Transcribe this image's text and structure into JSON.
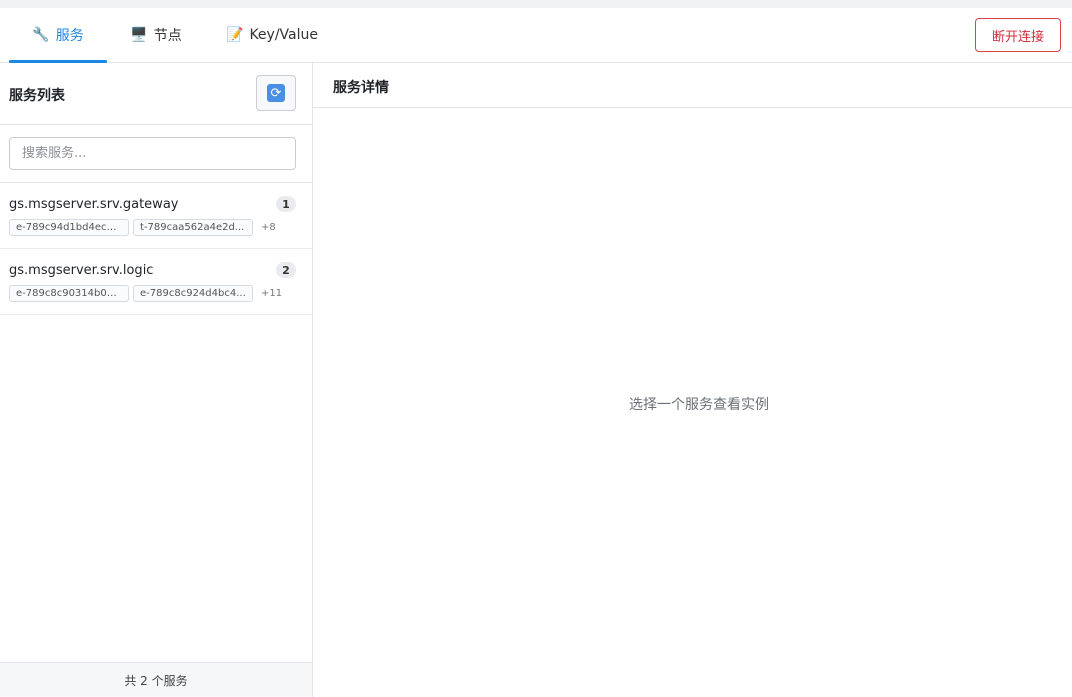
{
  "tabs": [
    {
      "icon": "🔧",
      "label": "服务",
      "active": true
    },
    {
      "icon": "🖥️",
      "label": "节点",
      "active": false
    },
    {
      "icon": "📝",
      "label": "Key/Value",
      "active": false
    }
  ],
  "disconnect_label": "断开连接",
  "services_panel": {
    "title": "服务列表",
    "refresh_icon": "refresh-icon",
    "search_placeholder": "搜索服务...",
    "items": [
      {
        "name": "gs.msgserver.srv.gateway",
        "count": "1",
        "tags": [
          "e-789c94d1bd4ec4...",
          "t-789caa562a4e2d..."
        ],
        "more": "+8"
      },
      {
        "name": "gs.msgserver.srv.logic",
        "count": "2",
        "tags": [
          "e-789c8c90314b04...",
          "e-789c8c924d4bc4..."
        ],
        "more": "+11"
      }
    ],
    "footer": "共 2 个服务"
  },
  "detail_panel": {
    "title": "服务详情",
    "empty_message": "选择一个服务查看实例"
  },
  "colors": {
    "accent": "#1e88e5",
    "danger": "#d02f3c"
  }
}
